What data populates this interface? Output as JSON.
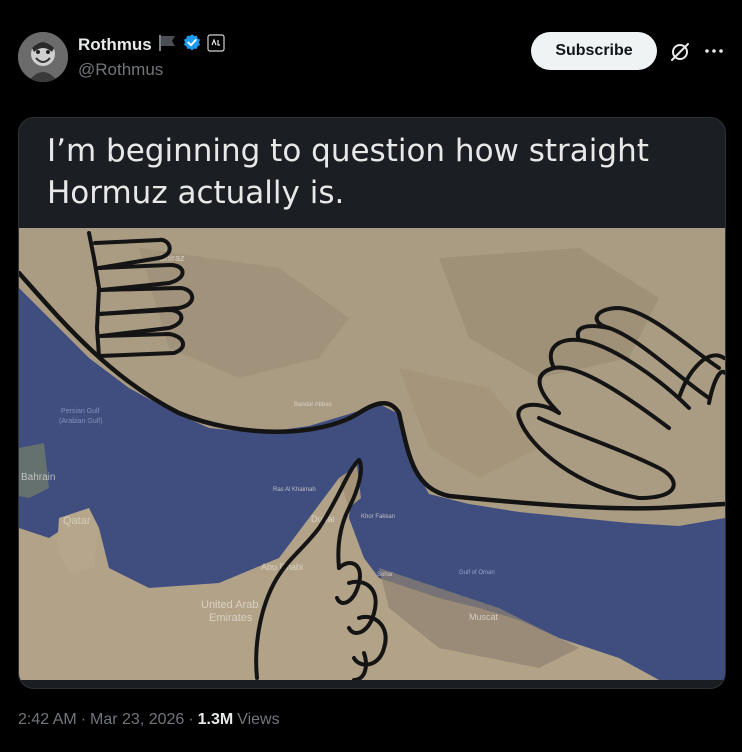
{
  "author": {
    "display_name": "Rothmus",
    "handle": "@Rothmus",
    "verified_color": "#1d9bf0"
  },
  "actions": {
    "subscribe_label": "Subscribe"
  },
  "media": {
    "caption": "I’m beginning to question how straight Hormuz actually is.",
    "map_labels": {
      "shiraz": "Shiraz",
      "persian_gulf": "Persian Gulf\n(Arabian Gulf)",
      "bahrain": "Bahrain",
      "qatar": "Qatar",
      "ras_al_khaimah": "Ras Al Khaimah",
      "dubai": "Dubai",
      "abu_dhabi": "Abu Dhabi",
      "uae": "United Arab\nEmirates",
      "sohar": "Sohar",
      "khor_fakkan": "Khor Fakkan",
      "gulf_of_oman": "Gulf of Oman",
      "muscat": "Muscat",
      "bandar_abbas": "Bandar Abbas"
    }
  },
  "meta": {
    "time": "2:42 AM",
    "separator": "·",
    "date": "Mar 23, 2026",
    "views_count": "1.3M",
    "views_label": "Views"
  },
  "colors": {
    "background": "#000000",
    "text_primary": "#e7e9ea",
    "text_secondary": "#71767b",
    "water": "#3e4d7e",
    "land": "#a89a83"
  },
  "icons": [
    "flag-icon",
    "verified-badge-icon",
    "affiliate-badge-icon",
    "grok-icon",
    "more-options-icon"
  ]
}
